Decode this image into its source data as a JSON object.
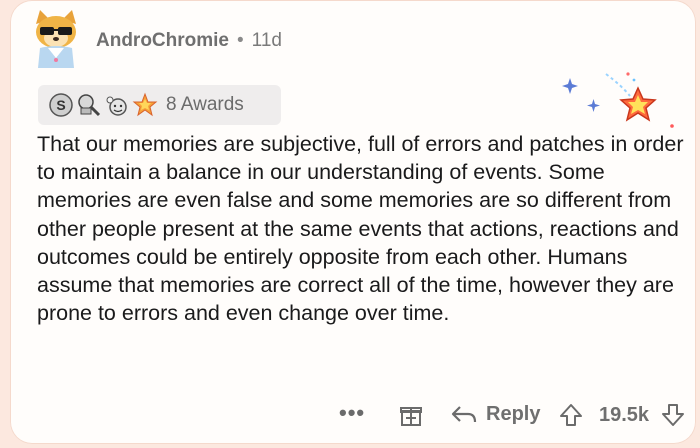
{
  "comment": {
    "username": "AndroChromie",
    "separator": "•",
    "age": "11d",
    "awards": {
      "label": "8 Awards",
      "icons": [
        "silver-award-icon",
        "helpful-award-icon",
        "wholesome-award-icon",
        "starstruck-award-icon"
      ]
    },
    "body": "That our memories are subjective, full of errors and patches in order to maintain a balance in our understanding of events. Some memories are even false and some memories are so different from other people present at the same events that actions, reactions and outcomes could be entirely opposite from each other. Humans assume that memories are correct all of the time, however they are prone to errors and even change over time.",
    "footer": {
      "more": "•••",
      "reply_label": "Reply",
      "score": "19.5k"
    }
  },
  "colors": {
    "background": "#fce8df",
    "card": "#fffdfb",
    "text": "#1a1a1b",
    "muted": "#6b6b6b",
    "award_bar": "#efeded"
  }
}
